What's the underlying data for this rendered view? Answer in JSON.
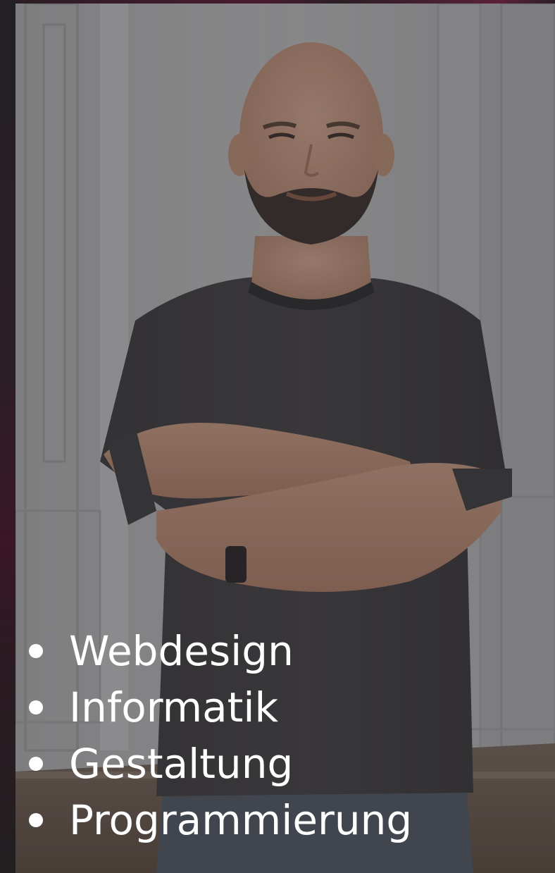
{
  "hero": {
    "photo_alt": "portrait-photo",
    "overlay_color": "#282628"
  },
  "skills": {
    "items": [
      {
        "label": "Webdesign"
      },
      {
        "label": "Informatik"
      },
      {
        "label": "Gestaltung"
      },
      {
        "label": "Programmierung"
      }
    ]
  },
  "colors": {
    "text": "#ffffff",
    "accent": "#5a2038",
    "background": "#1c1b1d"
  }
}
